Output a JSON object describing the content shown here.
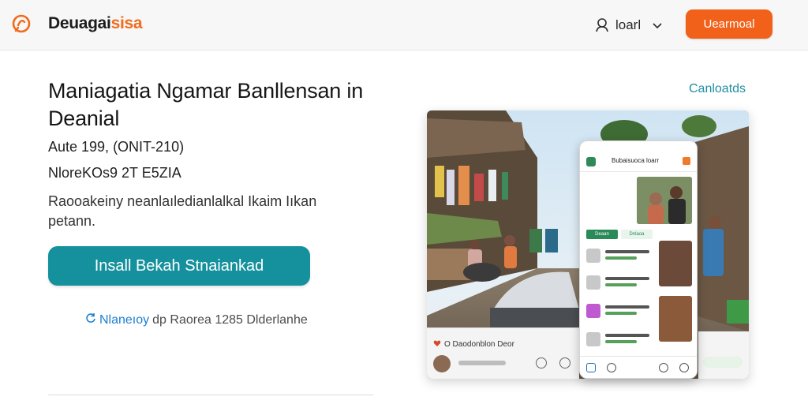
{
  "header": {
    "brand_main": "Deuagai",
    "brand_accent": "sisa",
    "user_label": "loarl",
    "cta_label": "Uearmoal"
  },
  "hero": {
    "title": "Maniagatia Ngamar Banllensan in Deanial",
    "meta_1": "Aute 199, (ONIT-210)",
    "meta_2": "NloreKOs9 2T E5ZIA",
    "description": "Raooakeiny neanlaıledianlalkal Ikaim Iıkan petann.",
    "install_label": "Insall Bekah Stnaiankad",
    "sub_note_blue": "Nlaneıoy",
    "sub_note_rest": "dp Raorea 1285 Dlderlanhe"
  },
  "side": {
    "contacts_label": "Canloatds"
  },
  "preview": {
    "left_caption": "O Daodonblon Deor",
    "app_title": "Bubaisuoca loarr",
    "tab_1": "Deaan",
    "tab_2": "Dnlaoa"
  },
  "colors": {
    "brand_accent": "#f26a1b",
    "cta": "#f1611a",
    "install": "#15919d",
    "link": "#1f8fa5"
  },
  "icons": [
    "brand-logo-icon",
    "user-icon",
    "chevron-down-icon",
    "refresh-icon",
    "heart-icon"
  ]
}
